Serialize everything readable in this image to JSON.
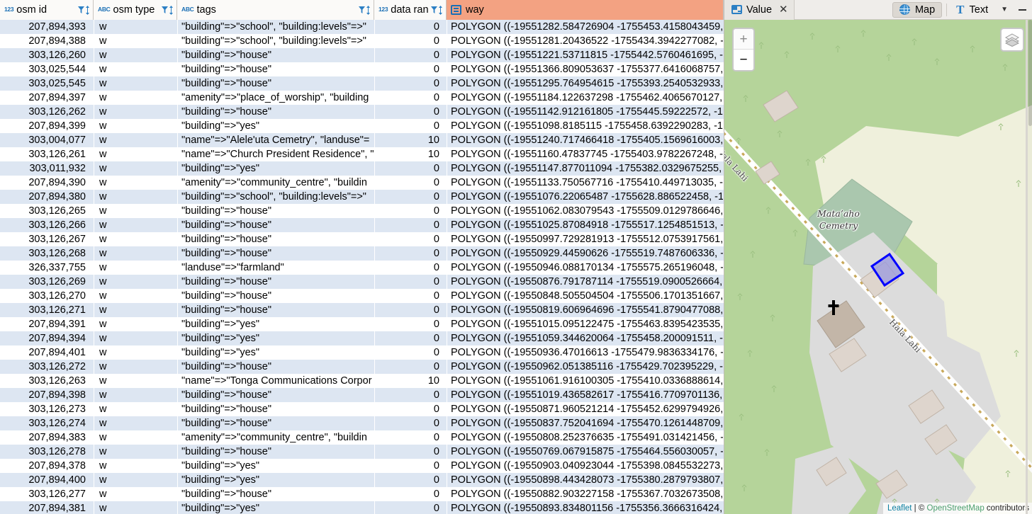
{
  "table": {
    "columns": [
      {
        "key": "osm_id",
        "label": "osm id",
        "type_icon": "123-icon",
        "type_badge": "123",
        "active": false,
        "filter_icon": "filter-icon",
        "sort_icon": "sort-icon"
      },
      {
        "key": "osm_type",
        "label": "osm type",
        "type_icon": "abc-icon",
        "type_badge": "ABC",
        "active": false,
        "filter_icon": "filter-icon",
        "sort_icon": "sort-icon"
      },
      {
        "key": "tags",
        "label": "tags",
        "type_icon": "abc-icon",
        "type_badge": "ABC",
        "active": false,
        "filter_icon": "filter-icon",
        "sort_icon": "sort-icon"
      },
      {
        "key": "data_ran",
        "label": "data ran",
        "type_icon": "123-icon",
        "type_badge": "123",
        "active": false,
        "filter_icon": "filter-icon",
        "sort_icon": "sort-icon"
      },
      {
        "key": "way",
        "label": "way",
        "type_icon": "geometry-icon",
        "type_badge": "",
        "active": true,
        "filter_icon": "",
        "sort_icon": ""
      }
    ],
    "rows": [
      {
        "osm_id": "207,894,393",
        "osm_type": "w",
        "tags": "\"building\"=>\"school\", \"building:levels\"=>\"",
        "data_ran": "0",
        "way": "POLYGON ((-19551282.584726904 -1755453.4158043459, -"
      },
      {
        "osm_id": "207,894,388",
        "osm_type": "w",
        "tags": "\"building\"=>\"school\", \"building:levels\"=>\"",
        "data_ran": "0",
        "way": "POLYGON ((-19551281.20436522 -1755434.3942277082, -1"
      },
      {
        "osm_id": "303,126,260",
        "osm_type": "w",
        "tags": "\"building\"=>\"house\"",
        "data_ran": "0",
        "way": "POLYGON ((-19551221.53711815 -1755442.5760461695, -1"
      },
      {
        "osm_id": "303,025,544",
        "osm_type": "w",
        "tags": "\"building\"=>\"house\"",
        "data_ran": "0",
        "way": "POLYGON ((-19551366.809053637 -1755377.6416068757, -"
      },
      {
        "osm_id": "303,025,545",
        "osm_type": "w",
        "tags": "\"building\"=>\"house\"",
        "data_ran": "0",
        "way": "POLYGON ((-19551295.764954615 -1755393.2540532933, -"
      },
      {
        "osm_id": "207,894,397",
        "osm_type": "w",
        "tags": "\"amenity\"=>\"place_of_worship\", \"building",
        "data_ran": "0",
        "way": "POLYGON ((-19551184.122637298 -1755462.4065670127, -"
      },
      {
        "osm_id": "303,126,262",
        "osm_type": "w",
        "tags": "\"building\"=>\"house\"",
        "data_ran": "0",
        "way": "POLYGON ((-19551142.912161805 -1755445.59222572, -19"
      },
      {
        "osm_id": "207,894,399",
        "osm_type": "w",
        "tags": "\"building\"=>\"yes\"",
        "data_ran": "0",
        "way": "POLYGON ((-19551098.8185115 -1755458.6392290283, -19"
      },
      {
        "osm_id": "303,004,077",
        "osm_type": "w",
        "tags": "\"name\"=>\"Alele'uta Cemetry\", \"landuse\"=",
        "data_ran": "10",
        "way": "POLYGON ((-19551240.717466418 -1755405.1569616003, -"
      },
      {
        "osm_id": "303,126,261",
        "osm_type": "w",
        "tags": "\"name\"=>\"Church President Residence\", \"",
        "data_ran": "10",
        "way": "POLYGON ((-19551160.47837745 -1755403.9782267248, -1"
      },
      {
        "osm_id": "303,011,932",
        "osm_type": "w",
        "tags": "\"building\"=>\"yes\"",
        "data_ran": "0",
        "way": "POLYGON ((-19551147.877011094 -1755382.0329675255, -"
      },
      {
        "osm_id": "207,894,390",
        "osm_type": "w",
        "tags": "\"amenity\"=>\"community_centre\", \"buildin",
        "data_ran": "0",
        "way": "POLYGON ((-19551133.750567716 -1755410.449713035, -1"
      },
      {
        "osm_id": "207,894,380",
        "osm_type": "w",
        "tags": "\"building\"=>\"school\", \"building:levels\"=>\"",
        "data_ran": "0",
        "way": "POLYGON ((-19551076.22065487 -1755628.886522458, -19"
      },
      {
        "osm_id": "303,126,265",
        "osm_type": "w",
        "tags": "\"building\"=>\"house\"",
        "data_ran": "0",
        "way": "POLYGON ((-19551062.083079543 -1755509.0129786646, -"
      },
      {
        "osm_id": "303,126,266",
        "osm_type": "w",
        "tags": "\"building\"=>\"house\"",
        "data_ran": "0",
        "way": "POLYGON ((-19551025.87084918 -1755517.1254851513, -1"
      },
      {
        "osm_id": "303,126,267",
        "osm_type": "w",
        "tags": "\"building\"=>\"house\"",
        "data_ran": "0",
        "way": "POLYGON ((-19550997.729281913 -1755512.0753917561, -"
      },
      {
        "osm_id": "303,126,268",
        "osm_type": "w",
        "tags": "\"building\"=>\"house\"",
        "data_ran": "0",
        "way": "POLYGON ((-19550929.44590626 -1755519.7487606336, -1"
      },
      {
        "osm_id": "326,337,755",
        "osm_type": "w",
        "tags": "\"landuse\"=>\"farmland\"",
        "data_ran": "0",
        "way": "POLYGON ((-19550946.088170134 -1755575.265196048, -1"
      },
      {
        "osm_id": "303,126,269",
        "osm_type": "w",
        "tags": "\"building\"=>\"house\"",
        "data_ran": "0",
        "way": "POLYGON ((-19550876.791787114 -1755519.0900526664, -"
      },
      {
        "osm_id": "303,126,270",
        "osm_type": "w",
        "tags": "\"building\"=>\"house\"",
        "data_ran": "0",
        "way": "POLYGON ((-19550848.505504504 -1755506.1701351667, -"
      },
      {
        "osm_id": "303,126,271",
        "osm_type": "w",
        "tags": "\"building\"=>\"house\"",
        "data_ran": "0",
        "way": "POLYGON ((-19550819.606964696 -1755541.8790477088, -"
      },
      {
        "osm_id": "207,894,391",
        "osm_type": "w",
        "tags": "\"building\"=>\"yes\"",
        "data_ran": "0",
        "way": "POLYGON ((-19551015.095122475 -1755463.8395423535, -"
      },
      {
        "osm_id": "207,894,394",
        "osm_type": "w",
        "tags": "\"building\"=>\"yes\"",
        "data_ran": "0",
        "way": "POLYGON ((-19551059.344620064 -1755458.200091511, -1"
      },
      {
        "osm_id": "207,894,401",
        "osm_type": "w",
        "tags": "\"building\"=>\"yes\"",
        "data_ran": "0",
        "way": "POLYGON ((-19550936.47016613 -1755479.9836334176, -1"
      },
      {
        "osm_id": "303,126,272",
        "osm_type": "w",
        "tags": "\"building\"=>\"house\"",
        "data_ran": "0",
        "way": "POLYGON ((-19550962.051385116 -1755429.702395229, -1"
      },
      {
        "osm_id": "303,126,263",
        "osm_type": "w",
        "tags": "\"name\"=>\"Tonga Communications Corpor",
        "data_ran": "10",
        "way": "POLYGON ((-19551061.916100305 -1755410.0336888614, -"
      },
      {
        "osm_id": "207,894,398",
        "osm_type": "w",
        "tags": "\"building\"=>\"house\"",
        "data_ran": "0",
        "way": "POLYGON ((-19551019.436582617 -1755416.7709701136, -"
      },
      {
        "osm_id": "303,126,273",
        "osm_type": "w",
        "tags": "\"building\"=>\"house\"",
        "data_ran": "0",
        "way": "POLYGON ((-19550871.960521214 -1755452.6299794926, -"
      },
      {
        "osm_id": "303,126,274",
        "osm_type": "w",
        "tags": "\"building\"=>\"house\"",
        "data_ran": "0",
        "way": "POLYGON ((-19550837.752041694 -1755470.1261448709, -"
      },
      {
        "osm_id": "207,894,383",
        "osm_type": "w",
        "tags": "\"amenity\"=>\"community_centre\", \"buildin",
        "data_ran": "0",
        "way": "POLYGON ((-19550808.252376635 -1755491.031421456, -1"
      },
      {
        "osm_id": "303,126,278",
        "osm_type": "w",
        "tags": "\"building\"=>\"house\"",
        "data_ran": "0",
        "way": "POLYGON ((-19550769.067915875 -1755464.556030057, -1"
      },
      {
        "osm_id": "207,894,378",
        "osm_type": "w",
        "tags": "\"building\"=>\"yes\"",
        "data_ran": "0",
        "way": "POLYGON ((-19550903.040923044 -1755398.0845532273, -"
      },
      {
        "osm_id": "207,894,400",
        "osm_type": "w",
        "tags": "\"building\"=>\"yes\"",
        "data_ran": "0",
        "way": "POLYGON ((-19550898.443428073 -1755380.2879793807, -"
      },
      {
        "osm_id": "303,126,277",
        "osm_type": "w",
        "tags": "\"building\"=>\"house\"",
        "data_ran": "0",
        "way": "POLYGON ((-19550882.903227158 -1755367.7032673508, -"
      },
      {
        "osm_id": "207,894,381",
        "osm_type": "w",
        "tags": "\"building\"=>\"yes\"",
        "data_ran": "0",
        "way": "POLYGON ((-19550893.834801156 -1755356.3666316424, -"
      }
    ]
  },
  "map_panel": {
    "tab_label": "Value",
    "tab_icon": "value-panel-icon",
    "tab_close_icon": "close-icon",
    "map_button_label": "Map",
    "map_button_icon": "globe-icon",
    "text_button_label": "Text",
    "text_button_icon": "text-T-icon",
    "dropdown_icon": "chevron-down-icon",
    "minimize_icon": "minimize-icon",
    "zoom_in_label": "+",
    "zoom_out_label": "−",
    "layers_icon": "layers-icon",
    "labels": {
      "cemetery": "Mata’aho Cemetry",
      "road_upper": "Hala Lahi",
      "road_lower": "Hala Lahi"
    },
    "attribution": {
      "leaflet": "Leaflet",
      "separator": " | ",
      "copyright": "© ",
      "osm": "OpenStreetMap",
      "contributors": " contributors"
    },
    "colors": {
      "vegetation": "#b5d49a",
      "cemetery_fill": "#aac7ae",
      "field_fill": "#eff0dc",
      "urban_fill": "#dddddd",
      "building_fill": "#d9d0c9",
      "place_of_worship_fill": "#c3b6a8",
      "selection_stroke": "#0000ff",
      "selection_fill": "#9a9ade",
      "track_casing": "#ffffff",
      "track_dash": "#c8a85a"
    }
  }
}
